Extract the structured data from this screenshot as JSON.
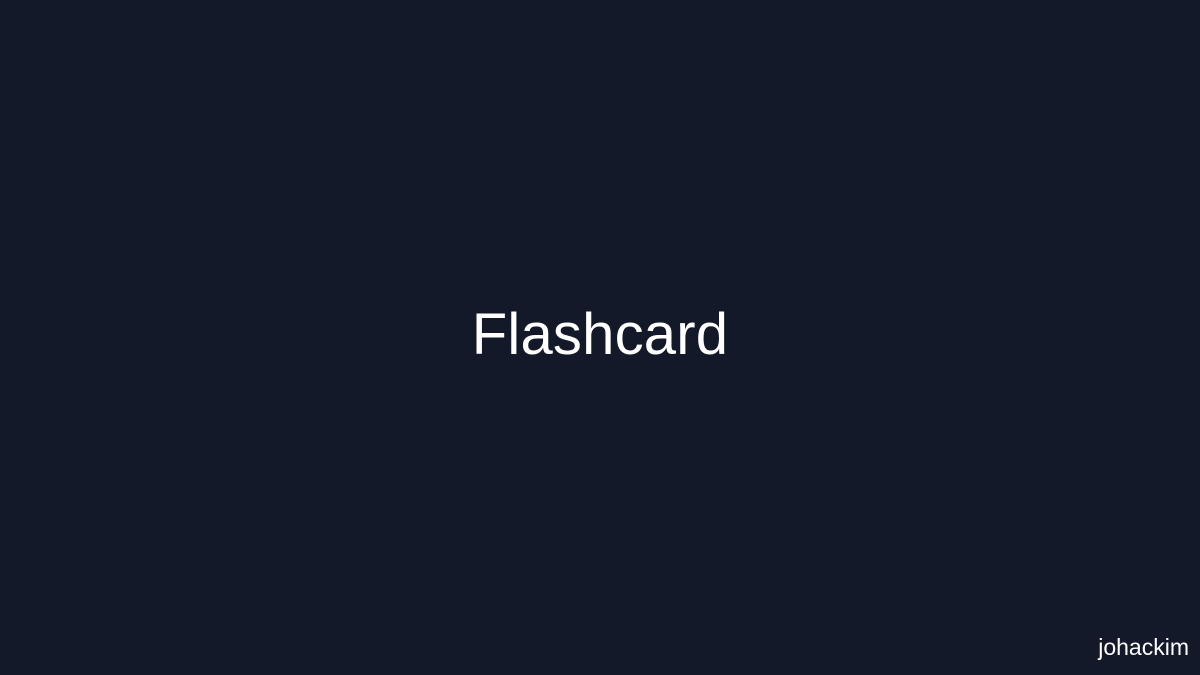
{
  "screen": {
    "title": "Flashcard",
    "author": "johackim"
  },
  "colors": {
    "background": "#131928",
    "text": "#ffffff"
  }
}
